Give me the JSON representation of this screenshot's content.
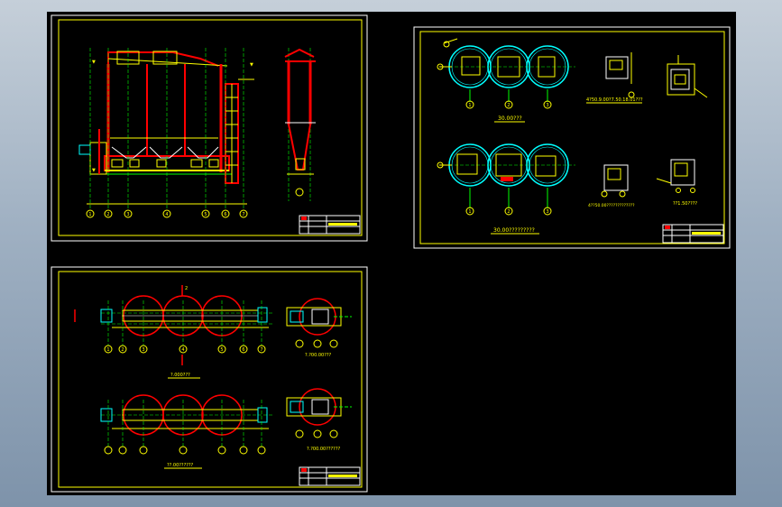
{
  "viewer": {
    "background": "#000000",
    "frame_color": "#ffffff",
    "border_color": "#ffff00",
    "wall_color": "#ff0000",
    "axis_color": "#00ff00",
    "detail_color": "#00ffff"
  },
  "sheets": {
    "sheet1": {
      "grid_labels": [
        "1",
        "2",
        "3",
        "4",
        "5",
        "6",
        "7"
      ]
    },
    "sheet2": {
      "plan_top_caption": "30.00???",
      "plan_bottom_caption": "30.00?????????",
      "detail_a_caption": "4?50.9.00?7.50.18.01???",
      "detail_b_caption": "4??50.00?????????????",
      "detail_c_caption": "??1.50????",
      "grid_labels": [
        "1",
        "2",
        "3"
      ]
    },
    "sheet3": {
      "plan_top_caption": "?.000???",
      "plan_bottom_caption": "??.00??????",
      "side_top_caption": "?.?00.00???",
      "side_bottom_caption": "?.?00.00??????",
      "section_mark": "2",
      "grid_labels": [
        "1",
        "2",
        "3",
        "4",
        "5",
        "6",
        "7"
      ]
    }
  }
}
